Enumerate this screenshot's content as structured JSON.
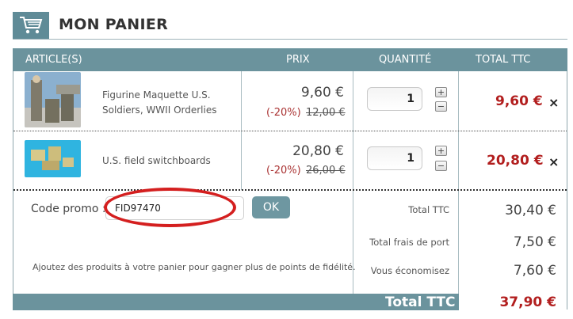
{
  "header": {
    "title": "MON PANIER",
    "icon": "shopping-cart-icon",
    "accent": "#6b939d"
  },
  "table": {
    "columns": [
      "ARTICLE(S)",
      "PRIX",
      "QUANTITÉ",
      "TOTAL TTC"
    ],
    "rows": [
      {
        "name_line1": "Figurine Maquette U.S.",
        "name_line2": "Soldiers, WWII Orderlies",
        "price": "9,60 €",
        "discount": "(-20%)",
        "old_price": "12,00 €",
        "quantity": "1",
        "total": "9,60 €",
        "remove": "×"
      },
      {
        "name_line1": "U.S. field switchboards",
        "name_line2": "",
        "price": "20,80 €",
        "discount": "(-20%)",
        "old_price": "26,00 €",
        "quantity": "1",
        "total": "20,80 €",
        "remove": "×"
      }
    ]
  },
  "promo": {
    "label": "Code promo :",
    "value": "FID97470",
    "ok_label": "OK",
    "loyalty_text": "Ajoutez des produits à votre panier pour gagner plus de points de fidélité."
  },
  "summary": {
    "total_ttc_label": "Total TTC",
    "total_ttc_value": "30,40 €",
    "shipping_label": "Total frais de port",
    "shipping_value": "7,50 €",
    "savings_label": "Vous économisez",
    "savings_value": "7,60 €"
  },
  "footer": {
    "label": "Total TTC",
    "value": "37,90 €"
  }
}
